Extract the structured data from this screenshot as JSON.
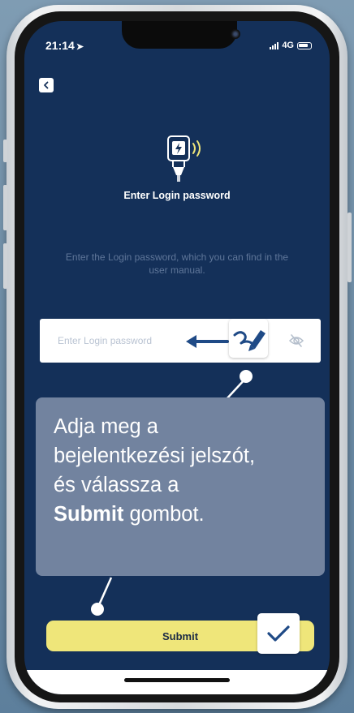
{
  "status_bar": {
    "time": "21:14",
    "network": "4G"
  },
  "screen": {
    "background_color": "#143059",
    "back_icon": "chevron-left-icon",
    "hero_icon": "charger-wireless-icon",
    "title": "Enter Login password",
    "instruction": "Enter the Login password, which you can find in the user manual.",
    "password_field": {
      "placeholder": "Enter Login password",
      "value": "",
      "toggle_icon": "eye-off-icon"
    },
    "submit_label": "Submit",
    "submit_color": "#efe67a"
  },
  "callout": {
    "line1": "Adja meg a",
    "line2": "bejelentkezési jelszót,",
    "line3": "és válassza a",
    "bold": "Submit",
    "tail": " gombot."
  },
  "annotations": {
    "arrow_icon": "arrow-left-icon",
    "edit_icon": "pen-edit-icon",
    "check_icon": "checkmark-icon"
  }
}
